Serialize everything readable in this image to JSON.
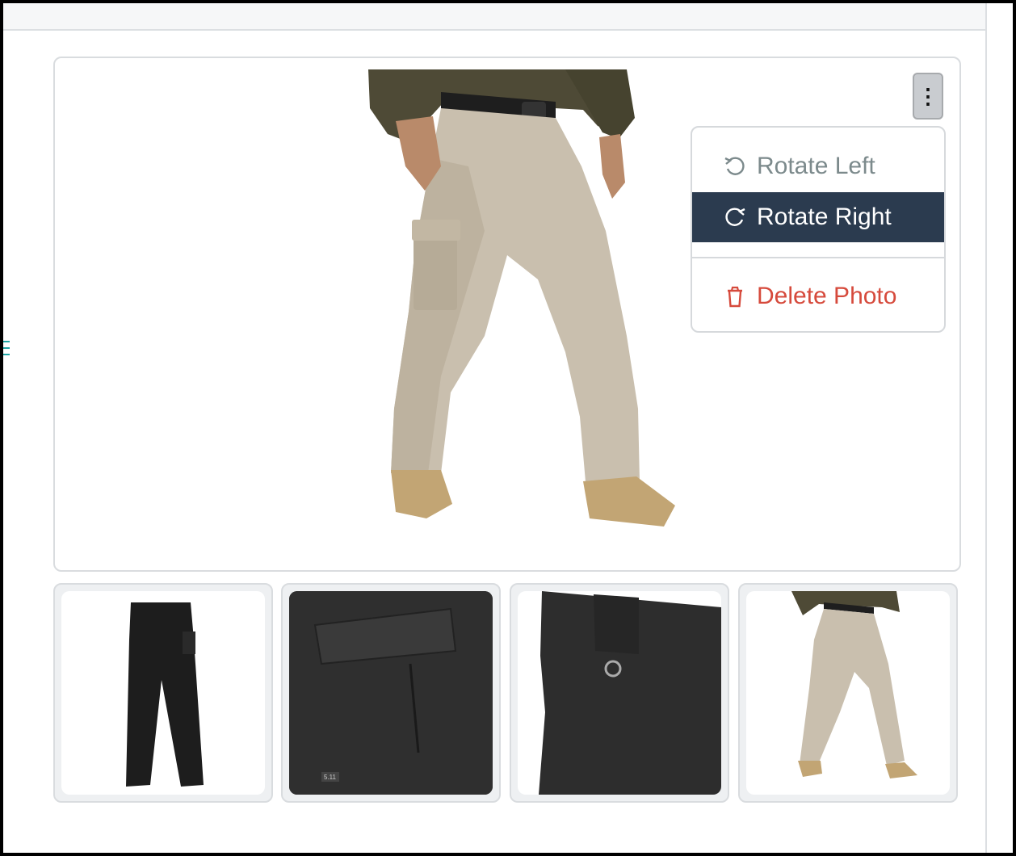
{
  "header": {},
  "photo_viewer": {
    "main_photo": {
      "subject": "khaki tactical pants on model"
    },
    "menu_button": {
      "glyph": "⋮",
      "icon": "kebab-vertical-icon"
    },
    "menu": {
      "items": [
        {
          "label": "Rotate Left",
          "icon": "rotate-left-icon",
          "highlighted": false,
          "color": "#7c8a8c"
        },
        {
          "label": "Rotate Right",
          "icon": "rotate-right-icon",
          "highlighted": true,
          "color": "#ffffff"
        },
        {
          "label": "Delete Photo",
          "icon": "trash-icon",
          "highlighted": false,
          "color": "#d64a3c"
        }
      ],
      "highlight_color": "#2b3b4f"
    }
  },
  "thumbnails": [
    {
      "subject": "black pants front view"
    },
    {
      "subject": "black pants cargo pocket close-up",
      "tag_text": "5.11"
    },
    {
      "subject": "black pants waistband D-ring close-up"
    },
    {
      "subject": "khaki pants on model"
    }
  ],
  "colors": {
    "border": "#d9dcdf",
    "delete": "#d64a3c",
    "muted": "#7c8a8c"
  }
}
